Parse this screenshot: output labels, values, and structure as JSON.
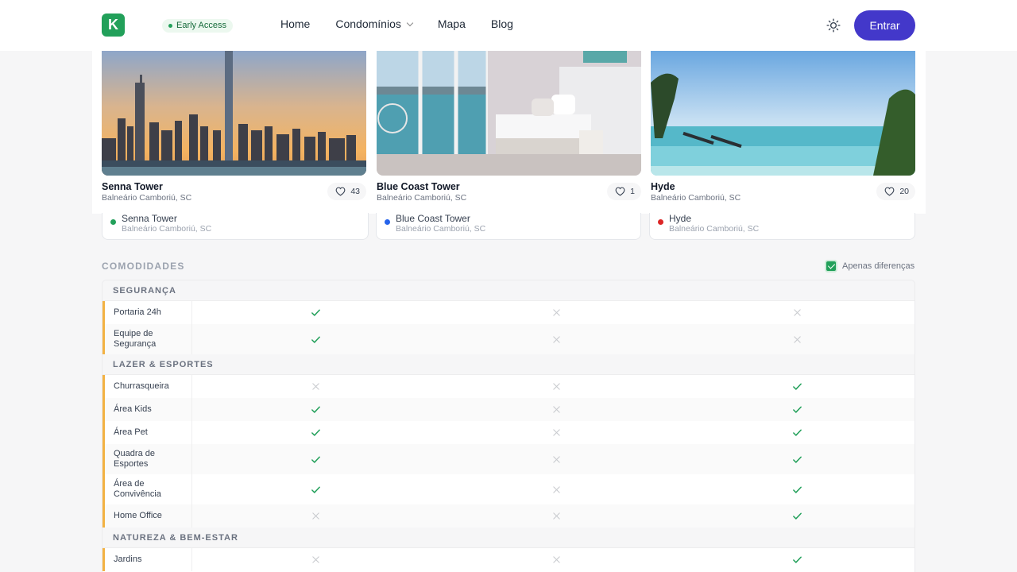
{
  "header": {
    "logo_letter": "K",
    "badge": "Early Access",
    "nav": [
      "Home",
      "Condomínios",
      "Mapa",
      "Blog"
    ],
    "enter_label": "Entrar"
  },
  "cards": [
    {
      "name": "Senna Tower",
      "location": "Balneário Camboriú, SC",
      "likes": "43",
      "image": "city-skyline-sunset"
    },
    {
      "name": "Blue Coast Tower",
      "location": "Balneário Camboriú, SC",
      "likes": "1",
      "image": "bedroom-sea-view"
    },
    {
      "name": "Hyde",
      "location": "Balneário Camboriú, SC",
      "likes": "20",
      "image": "infinity-pool"
    }
  ],
  "selection": [
    {
      "name": "Senna Tower",
      "location": "Balneário Camboriú, SC",
      "color": "#22a05a"
    },
    {
      "name": "Blue Coast Tower",
      "location": "Balneário Camboriú, SC",
      "color": "#2563eb"
    },
    {
      "name": "Hyde",
      "location": "Balneário Camboriú, SC",
      "color": "#dc2626"
    }
  ],
  "amenities": {
    "title": "COMODIDADES",
    "only_differences": "Apenas diferenças",
    "categories": [
      {
        "title": "SEGURANÇA",
        "rows": [
          {
            "label": "Portaria 24h",
            "values": [
              true,
              false,
              false
            ]
          },
          {
            "label": "Equipe de Segurança",
            "values": [
              true,
              false,
              false
            ]
          }
        ]
      },
      {
        "title": "LAZER & ESPORTES",
        "rows": [
          {
            "label": "Churrasqueira",
            "values": [
              false,
              false,
              true
            ]
          },
          {
            "label": "Área Kids",
            "values": [
              true,
              false,
              true
            ]
          },
          {
            "label": "Área Pet",
            "values": [
              true,
              false,
              true
            ]
          },
          {
            "label": "Quadra de Esportes",
            "values": [
              true,
              false,
              true
            ]
          },
          {
            "label": "Área de Convivência",
            "values": [
              true,
              false,
              true
            ]
          },
          {
            "label": "Home Office",
            "values": [
              false,
              false,
              true
            ]
          }
        ]
      },
      {
        "title": "NATUREZA & BEM-ESTAR",
        "rows": [
          {
            "label": "Jardins",
            "values": [
              false,
              false,
              true
            ]
          }
        ]
      }
    ]
  }
}
